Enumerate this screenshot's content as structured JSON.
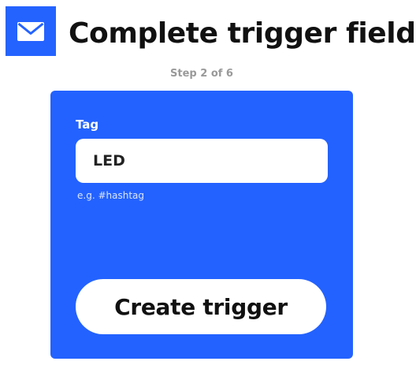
{
  "header": {
    "service_icon": "envelope-icon",
    "title": "Complete trigger fields",
    "step": "Step 2 of 6"
  },
  "colors": {
    "brand_blue": "#2362ff",
    "button_background": "#ffffff"
  },
  "form": {
    "field_label": "Tag",
    "field_value": "LED",
    "field_helper": "e.g. #hashtag",
    "submit_label": "Create trigger"
  }
}
